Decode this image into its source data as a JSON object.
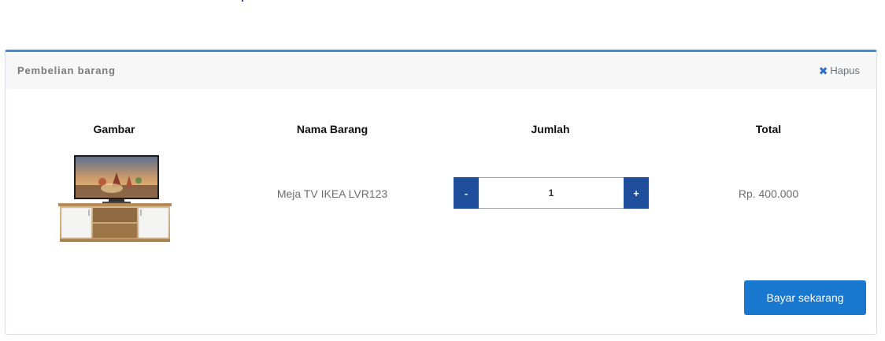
{
  "card": {
    "title": "Pembelian barang",
    "remove_icon": "close-icon",
    "remove_label": "Hapus"
  },
  "table": {
    "headers": [
      "Gambar",
      "Nama Barang",
      "Jumlah",
      "Total"
    ],
    "row": {
      "image": "tv-cabinet-product-image",
      "name": "Meja TV IKEA LVR123",
      "quantity": "1",
      "total": "Rp. 400.000"
    }
  },
  "quantity_controls": {
    "minus_label": "-",
    "plus_label": "+"
  },
  "actions": {
    "pay_label": "Bayar sekarang"
  },
  "colors": {
    "accent": "#3c8dd6",
    "stepper": "#1f4f9c",
    "primary_button": "#1877cf"
  }
}
